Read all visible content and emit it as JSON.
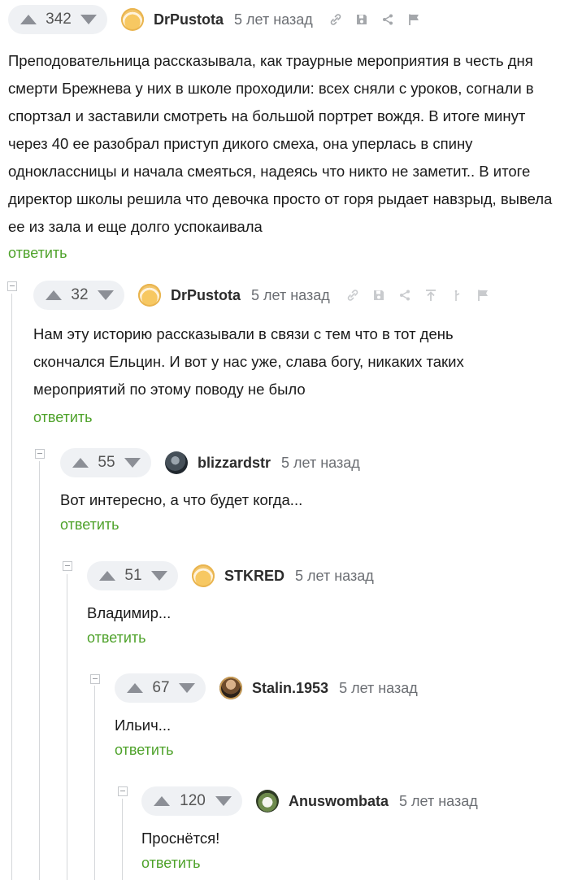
{
  "comments": [
    {
      "rating": "342",
      "author": "DrPustota",
      "time": "5 лет назад",
      "avatar": "pikabu-avatar",
      "icons": [
        "link-icon",
        "save-icon",
        "share-icon",
        "flag-icon"
      ],
      "text": "Преподовательница рассказывала, как траурные мероприятия в честь дня смерти Брежнева у них в школе проходили: всех сняли с уроков, согнали в спортзал и заставили смотреть на большой портрет вождя. В итоге минут через 40 ее разобрал приступ дикого смеха, она уперлась в спину одноклассницы и начала смеяться, надеясь что никто не заметит.. В итоге директор школы решила что девочка просто от горя рыдает навзрыд, вывела ее из зала и еще долго успокаивала",
      "reply": "ответить"
    },
    {
      "rating": "32",
      "author": "DrPustota",
      "time": "5 лет назад",
      "avatar": "pikabu-avatar",
      "icons": [
        "link-icon",
        "save-icon",
        "share-icon",
        "to-top-icon",
        "branch-icon",
        "flag-icon"
      ],
      "text": "Нам эту историю рассказывали в связи с тем что в тот день скончался Ельцин. И вот у нас уже, слава богу, никаких таких мероприятий по этому поводу не было",
      "reply": "ответить"
    },
    {
      "rating": "55",
      "author": "blizzardstr",
      "time": "5 лет назад",
      "avatar": "dark-avatar",
      "text": "Вот интересно, а что будет когда...",
      "reply": "ответить"
    },
    {
      "rating": "51",
      "author": "STKRED",
      "time": "5 лет назад",
      "avatar": "pikabu-avatar",
      "text": "Владимир...",
      "reply": "ответить"
    },
    {
      "rating": "67",
      "author": "Stalin.1953",
      "time": "5 лет назад",
      "avatar": "portrait-avatar",
      "text": "Ильич...",
      "reply": "ответить"
    },
    {
      "rating": "120",
      "author": "Anuswombata",
      "time": "5 лет назад",
      "avatar": "wombat-avatar",
      "text": "Проснётся!",
      "reply": "ответить"
    }
  ],
  "colors": {
    "reply_link": "#4ea22a",
    "rating_pill": "#eff1f4",
    "tree_line": "#d5d7da"
  }
}
